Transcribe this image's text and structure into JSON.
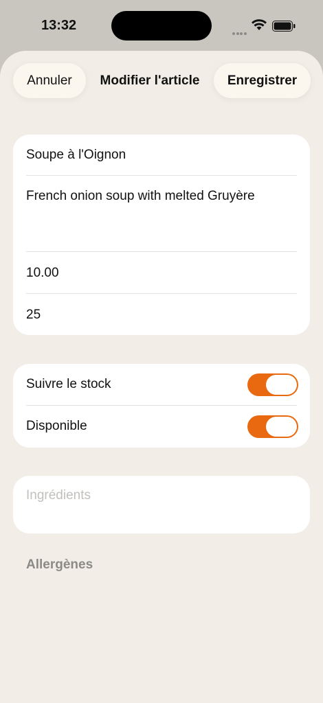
{
  "status": {
    "time": "13:32"
  },
  "nav": {
    "cancel": "Annuler",
    "title": "Modifier l'article",
    "save": "Enregistrer"
  },
  "form": {
    "name": "Soupe à l'Oignon",
    "description": "French onion soup with melted Gruyère",
    "price": "10.00",
    "quantity": "25"
  },
  "toggles": {
    "track_stock": {
      "label": "Suivre le stock",
      "on": true
    },
    "available": {
      "label": "Disponible",
      "on": true
    }
  },
  "ingredients": {
    "placeholder": "Ingrédients"
  },
  "allergens": {
    "label": "Allergènes"
  },
  "colors": {
    "accent": "#e8690f",
    "background": "#f2eee7",
    "card": "#ffffff"
  }
}
